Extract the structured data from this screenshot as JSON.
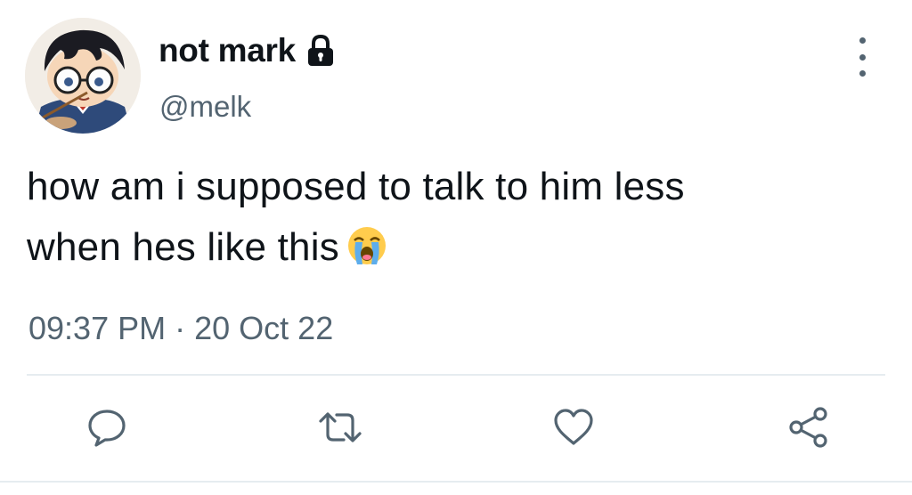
{
  "tweet": {
    "display_name": "not mark",
    "handle": "@melk",
    "text_lines": [
      "how am i supposed to talk to him less",
      "when hes like this"
    ],
    "time": "09:37 PM",
    "separator": "·",
    "date": "20 Oct 22",
    "emoji": "loudly-crying-face"
  },
  "icons": {
    "lock": "lock-icon",
    "more": "more-vertical-icon",
    "reply": "reply-icon",
    "retweet": "retweet-icon",
    "like": "heart-icon",
    "share": "share-icon"
  },
  "colors": {
    "text_primary": "#0f1419",
    "text_secondary": "#536471",
    "divider": "#e6ecf0"
  }
}
